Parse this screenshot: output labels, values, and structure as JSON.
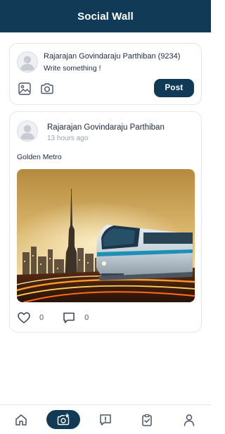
{
  "header": {
    "title": "Social Wall"
  },
  "composer": {
    "user_name": "Rajarajan Govindaraju Parthiban (9234)",
    "placeholder": "Write something !",
    "post_label": "Post",
    "icons": [
      "image-icon",
      "camera-icon"
    ]
  },
  "feed": {
    "posts": [
      {
        "author": "Rajarajan Govindaraju Parthiban",
        "time": "13 hours ago",
        "caption": "Golden Metro",
        "likes": "0",
        "comments": "0"
      }
    ]
  },
  "bottom_nav": {
    "items": [
      "home-icon",
      "add-photo-icon",
      "alert-message-icon",
      "clipboard-icon",
      "profile-icon"
    ],
    "active": "add-photo-icon"
  },
  "colors": {
    "primary": "#113a57",
    "background": "#ffffff",
    "border": "#e3e6ea"
  }
}
